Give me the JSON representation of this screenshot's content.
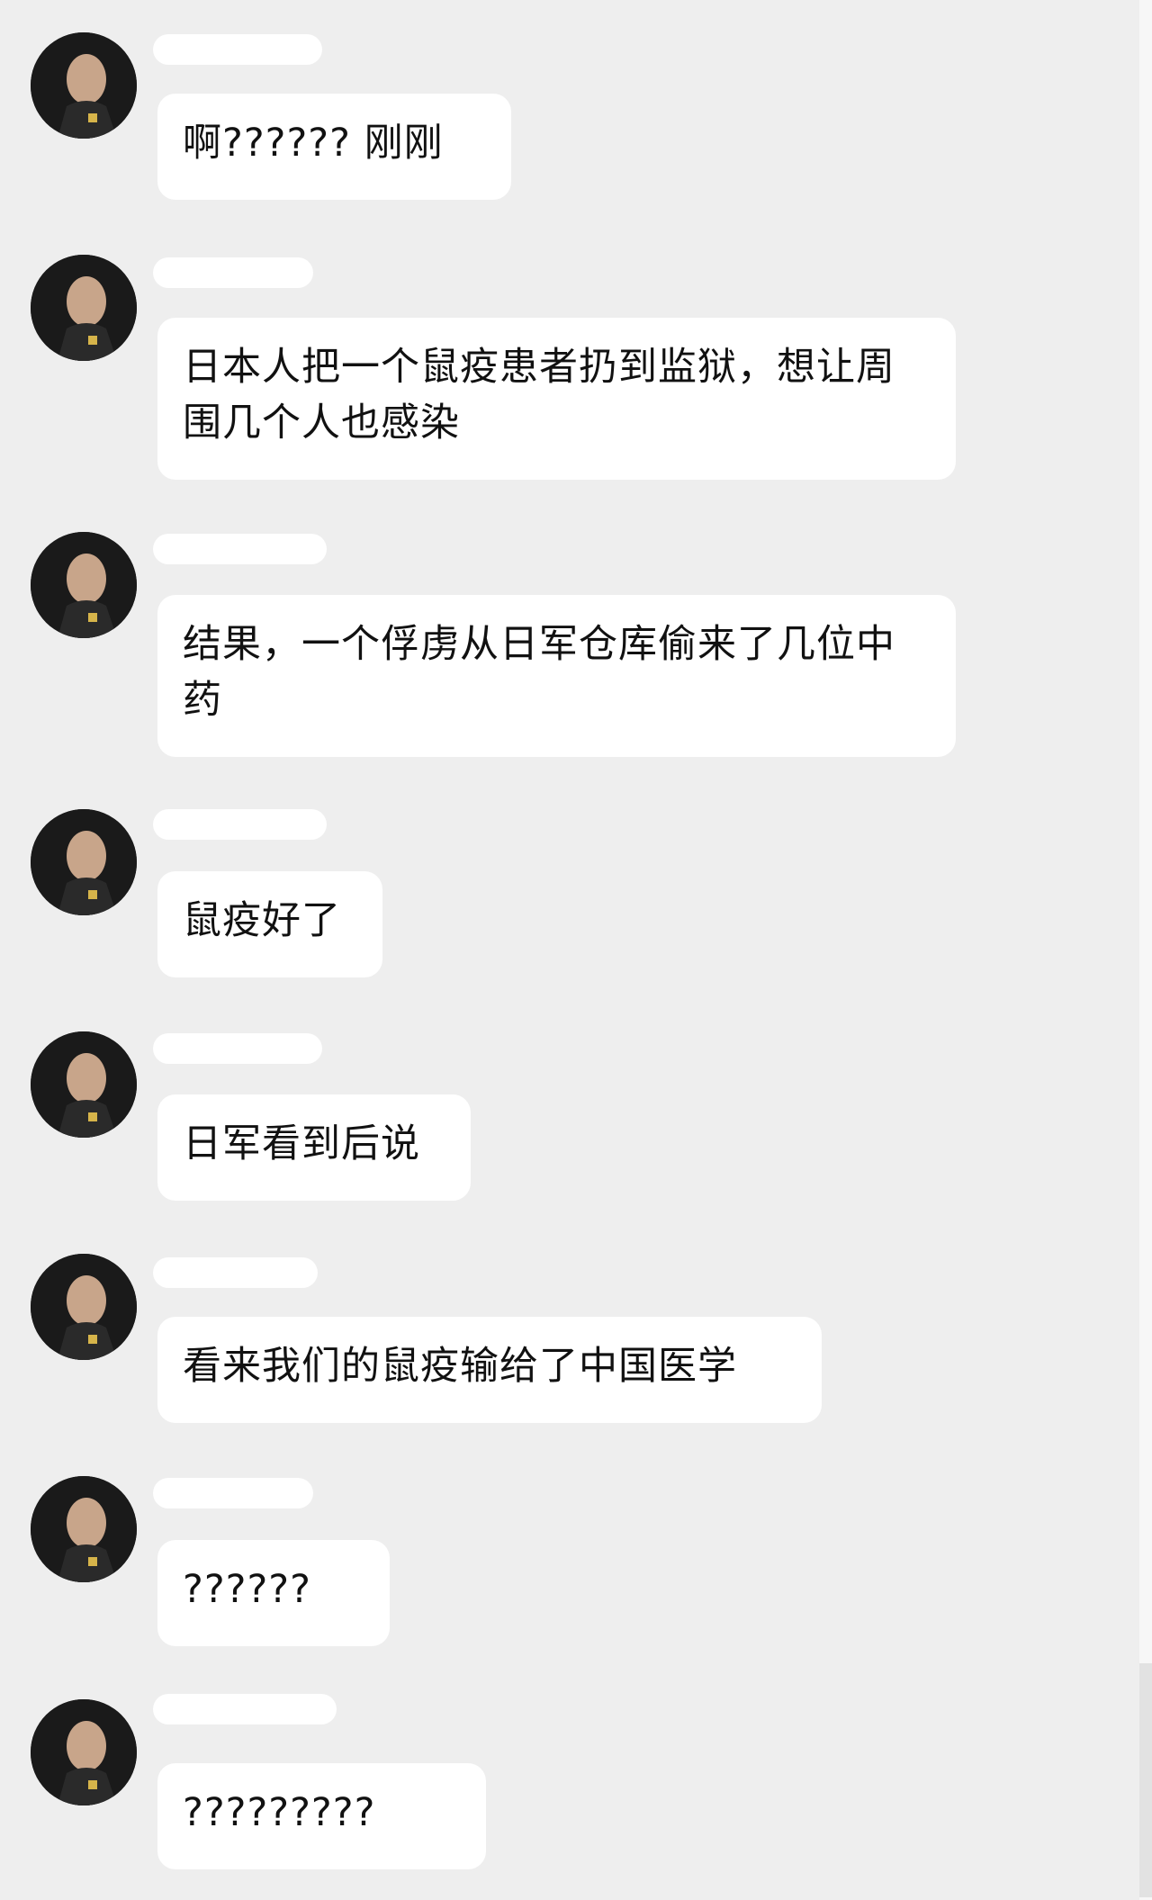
{
  "messages": [
    {
      "sender": "",
      "text": "啊?????? 刚刚"
    },
    {
      "sender": "",
      "text": "日本人把一个鼠疫患者扔到监狱，想让周围几个人也感染"
    },
    {
      "sender": "",
      "text": "结果，一个俘虏从日军仓库偷来了几位中药"
    },
    {
      "sender": "",
      "text": "鼠疫好了"
    },
    {
      "sender": "",
      "text": "日军看到后说"
    },
    {
      "sender": "",
      "text": "看来我们的鼠疫输给了中国医学"
    },
    {
      "sender": "",
      "text": "??????"
    },
    {
      "sender": "",
      "text": "?????????"
    }
  ],
  "icons": {
    "avatar": "avatar-portrait-icon"
  }
}
